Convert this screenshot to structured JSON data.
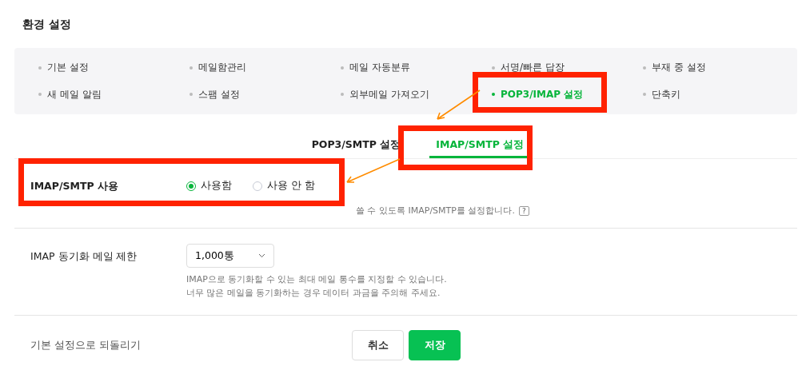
{
  "title": "환경 설정",
  "menu": [
    {
      "label": "기본 설정",
      "selected": false
    },
    {
      "label": "메일함관리",
      "selected": false
    },
    {
      "label": "메일 자동분류",
      "selected": false
    },
    {
      "label": "서명/빠른 답장",
      "selected": false
    },
    {
      "label": "부재 중 설정",
      "selected": false
    },
    {
      "label": "새 메일 알림",
      "selected": false
    },
    {
      "label": "스팸 설정",
      "selected": false
    },
    {
      "label": "외부메일 가져오기",
      "selected": false
    },
    {
      "label": "POP3/IMAP 설정",
      "selected": true
    },
    {
      "label": "단축키",
      "selected": false
    }
  ],
  "tabs": [
    {
      "label": "POP3/SMTP 설정",
      "selected": false
    },
    {
      "label": "IMAP/SMTP 설정",
      "selected": true
    }
  ],
  "imap_use": {
    "label": "IMAP/SMTP 사용",
    "options": [
      {
        "label": "사용함",
        "selected": true
      },
      {
        "label": "사용 안 함",
        "selected": false
      }
    ],
    "description": "쓸 수 있도록 IMAP/SMTP를 설정합니다.",
    "help": "?"
  },
  "sync_limit": {
    "label": "IMAP 동기화 메일 제한",
    "value": "1,000통",
    "description": [
      "IMAP으로 동기화할 수 있는 최대 메일 통수를 지정할 수 있습니다.",
      "너무 많은 메일을 동기화하는 경우 데이터 과금을 주의해 주세요."
    ]
  },
  "footer": {
    "reset": "기본 설정으로 되돌리기",
    "buttons": [
      {
        "label": "취소",
        "kind": "secondary"
      },
      {
        "label": "저장",
        "kind": "primary"
      }
    ]
  }
}
